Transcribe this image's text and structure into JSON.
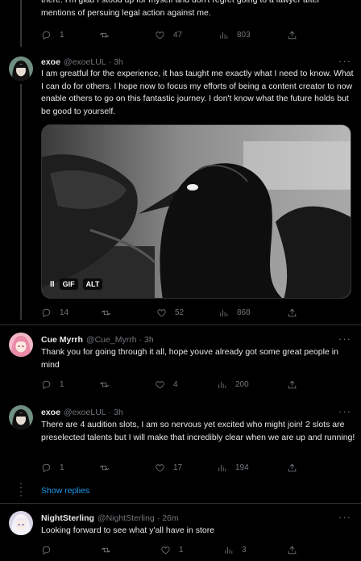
{
  "tweets": [
    {
      "text": "there. I'm glad I stood up for myself and don't regret going to a lawyer after mentions of persuing legal action against me.",
      "replies": "1",
      "retweets": "",
      "likes": "47",
      "views": "803"
    },
    {
      "name": "exoe",
      "handle": "@exoeLUL",
      "time": "3h",
      "text": "I am greatful for the experience, it has taught me exactly what I need to know. What I can do for others. I hope now to focus my efforts of being a content creator to now enable others to go on this fantastic journey. I don't know what the future holds but be good to yourself.",
      "media": {
        "pause": "II",
        "gif_label": "GIF",
        "alt_label": "ALT"
      },
      "replies": "14",
      "retweets": "",
      "likes": "52",
      "views": "868"
    },
    {
      "name": "Cue Myrrh",
      "handle": "@Cue_Myrrh",
      "time": "3h",
      "text": "Thank you for going through it all, hope youve already got some great people in mind",
      "replies": "1",
      "retweets": "",
      "likes": "4",
      "views": "200"
    },
    {
      "name": "exoe",
      "handle": "@exoeLUL",
      "time": "3h",
      "text": "There are 4 audition slots, I am so nervous yet excited who might join! 2 slots are preselected talents but I will make that incredibly clear when we are up and running!",
      "replies": "1",
      "retweets": "",
      "likes": "17",
      "views": "194"
    },
    {
      "name": "NightSterling",
      "handle": "@NightSterling",
      "time": "26m",
      "text": "Looking forward to see what y'all have in store",
      "replies": "",
      "retweets": "",
      "likes": "1",
      "views": "3"
    }
  ],
  "show_replies": "Show replies",
  "icons": {
    "reply": "reply-icon",
    "retweet": "retweet-icon",
    "like": "heart-icon",
    "views": "views-icon",
    "share": "share-icon",
    "more": "more-icon"
  },
  "colors": {
    "background": "#000000",
    "text": "#e7e9ea",
    "muted": "#71767b",
    "link": "#1d9bf0",
    "divider": "#2f3336"
  }
}
